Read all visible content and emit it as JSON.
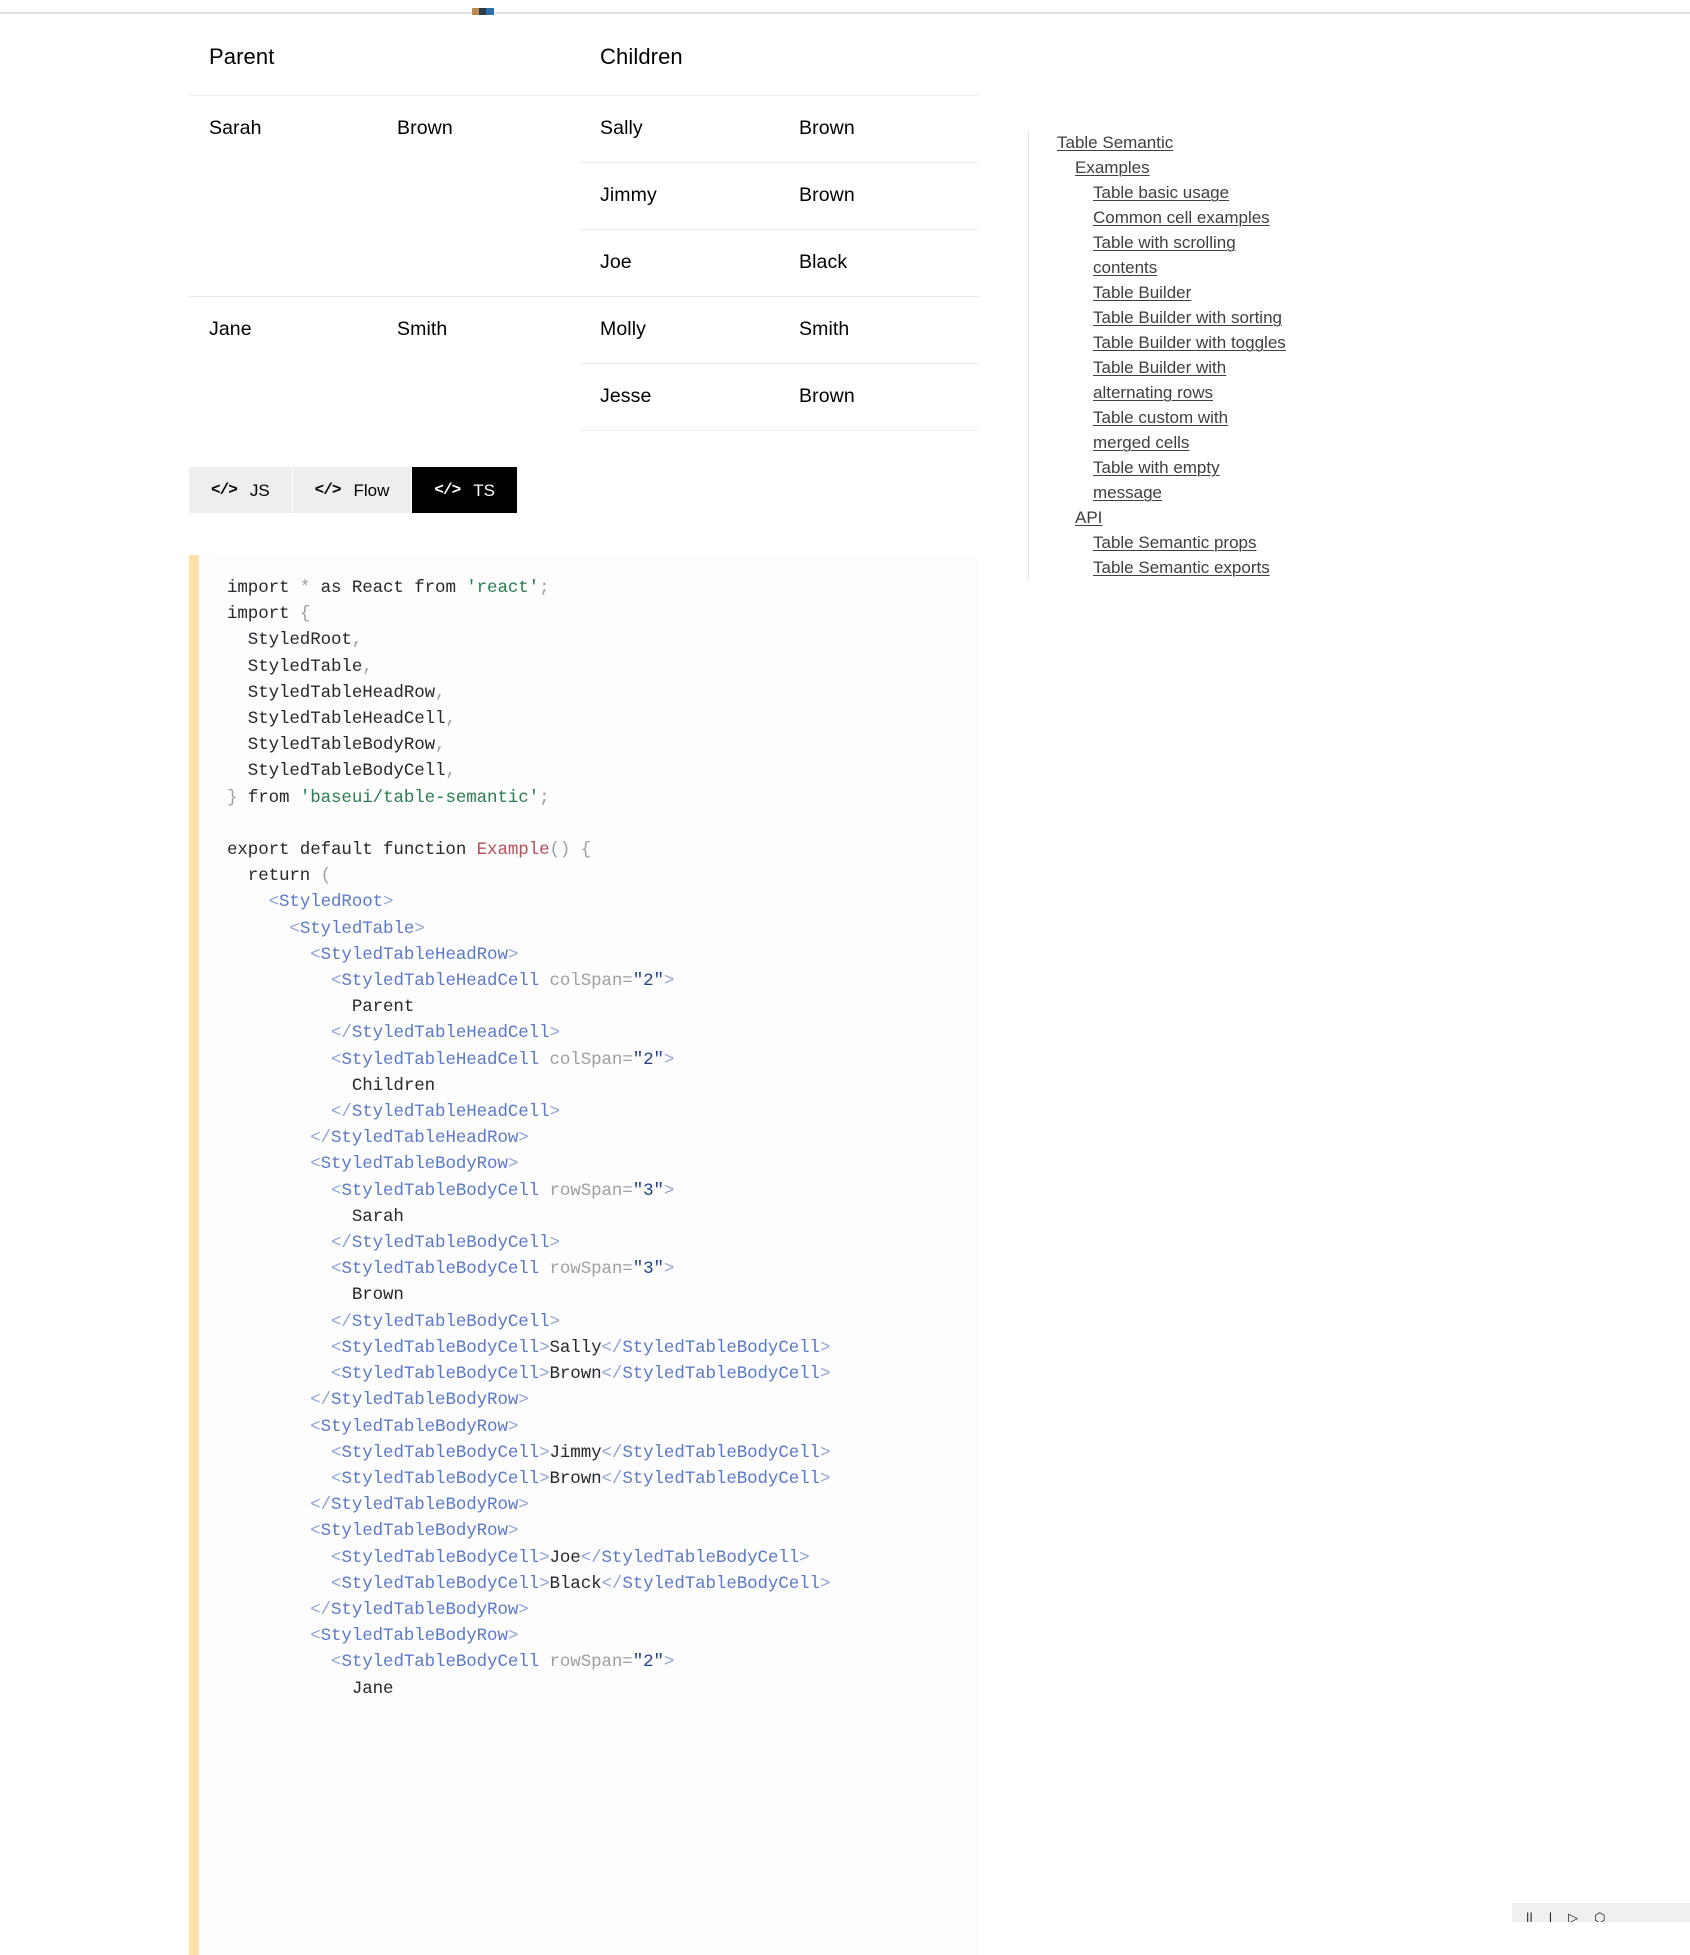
{
  "table": {
    "headers": [
      {
        "label": "Parent",
        "colspan": 2
      },
      {
        "label": "Children",
        "colspan": 2
      }
    ],
    "groups": [
      {
        "parent_first": "Sarah",
        "parent_last": "Brown",
        "rowspan": 3,
        "children": [
          {
            "first": "Sally",
            "last": "Brown"
          },
          {
            "first": "Jimmy",
            "last": "Brown"
          },
          {
            "first": "Joe",
            "last": "Black"
          }
        ]
      },
      {
        "parent_first": "Jane",
        "parent_last": "Smith",
        "rowspan": 2,
        "children": [
          {
            "first": "Molly",
            "last": "Smith"
          },
          {
            "first": "Jesse",
            "last": "Brown"
          }
        ]
      }
    ]
  },
  "tabs": {
    "icon": "</>",
    "items": [
      {
        "label": "JS",
        "active": false
      },
      {
        "label": "Flow",
        "active": false
      },
      {
        "label": "TS",
        "active": true
      }
    ]
  },
  "code": {
    "language": "TS",
    "lines": [
      [
        {
          "t": "import ",
          "c": "kw"
        },
        {
          "t": "* ",
          "c": "punc"
        },
        {
          "t": "as React from ",
          "c": "kw"
        },
        {
          "t": "'react'",
          "c": "str"
        },
        {
          "t": ";",
          "c": "punc"
        }
      ],
      [
        {
          "t": "import ",
          "c": "kw"
        },
        {
          "t": "{",
          "c": "punc"
        }
      ],
      [
        {
          "t": "  StyledRoot",
          "c": "kw"
        },
        {
          "t": ",",
          "c": "punc"
        }
      ],
      [
        {
          "t": "  StyledTable",
          "c": "kw"
        },
        {
          "t": ",",
          "c": "punc"
        }
      ],
      [
        {
          "t": "  StyledTableHeadRow",
          "c": "kw"
        },
        {
          "t": ",",
          "c": "punc"
        }
      ],
      [
        {
          "t": "  StyledTableHeadCell",
          "c": "kw"
        },
        {
          "t": ",",
          "c": "punc"
        }
      ],
      [
        {
          "t": "  StyledTableBodyRow",
          "c": "kw"
        },
        {
          "t": ",",
          "c": "punc"
        }
      ],
      [
        {
          "t": "  StyledTableBodyCell",
          "c": "kw"
        },
        {
          "t": ",",
          "c": "punc"
        }
      ],
      [
        {
          "t": "} ",
          "c": "punc"
        },
        {
          "t": "from ",
          "c": "kw"
        },
        {
          "t": "'baseui/table-semantic'",
          "c": "str"
        },
        {
          "t": ";",
          "c": "punc"
        }
      ],
      [],
      [
        {
          "t": "export default function ",
          "c": "kw"
        },
        {
          "t": "Example",
          "c": "fn"
        },
        {
          "t": "() {",
          "c": "punc"
        }
      ],
      [
        {
          "t": "  return ",
          "c": "kw"
        },
        {
          "t": "(",
          "c": "punc"
        }
      ],
      [
        {
          "t": "    ",
          "c": "kw"
        },
        {
          "t": "<",
          "c": "tagdim"
        },
        {
          "t": "StyledRoot",
          "c": "tag"
        },
        {
          "t": ">",
          "c": "tagdim"
        }
      ],
      [
        {
          "t": "      ",
          "c": "kw"
        },
        {
          "t": "<",
          "c": "tagdim"
        },
        {
          "t": "StyledTable",
          "c": "tag"
        },
        {
          "t": ">",
          "c": "tagdim"
        }
      ],
      [
        {
          "t": "        ",
          "c": "kw"
        },
        {
          "t": "<",
          "c": "tagdim"
        },
        {
          "t": "StyledTableHeadRow",
          "c": "tag"
        },
        {
          "t": ">",
          "c": "tagdim"
        }
      ],
      [
        {
          "t": "          ",
          "c": "kw"
        },
        {
          "t": "<",
          "c": "tagdim"
        },
        {
          "t": "StyledTableHeadCell ",
          "c": "tag"
        },
        {
          "t": "colSpan=",
          "c": "attr"
        },
        {
          "t": "\"2\"",
          "c": "attrval"
        },
        {
          "t": ">",
          "c": "tagdim"
        }
      ],
      [
        {
          "t": "            Parent",
          "c": "txt"
        }
      ],
      [
        {
          "t": "          ",
          "c": "kw"
        },
        {
          "t": "</",
          "c": "tagdim"
        },
        {
          "t": "StyledTableHeadCell",
          "c": "tag"
        },
        {
          "t": ">",
          "c": "tagdim"
        }
      ],
      [
        {
          "t": "          ",
          "c": "kw"
        },
        {
          "t": "<",
          "c": "tagdim"
        },
        {
          "t": "StyledTableHeadCell ",
          "c": "tag"
        },
        {
          "t": "colSpan=",
          "c": "attr"
        },
        {
          "t": "\"2\"",
          "c": "attrval"
        },
        {
          "t": ">",
          "c": "tagdim"
        }
      ],
      [
        {
          "t": "            Children",
          "c": "txt"
        }
      ],
      [
        {
          "t": "          ",
          "c": "kw"
        },
        {
          "t": "</",
          "c": "tagdim"
        },
        {
          "t": "StyledTableHeadCell",
          "c": "tag"
        },
        {
          "t": ">",
          "c": "tagdim"
        }
      ],
      [
        {
          "t": "        ",
          "c": "kw"
        },
        {
          "t": "</",
          "c": "tagdim"
        },
        {
          "t": "StyledTableHeadRow",
          "c": "tag"
        },
        {
          "t": ">",
          "c": "tagdim"
        }
      ],
      [
        {
          "t": "        ",
          "c": "kw"
        },
        {
          "t": "<",
          "c": "tagdim"
        },
        {
          "t": "StyledTableBodyRow",
          "c": "tag"
        },
        {
          "t": ">",
          "c": "tagdim"
        }
      ],
      [
        {
          "t": "          ",
          "c": "kw"
        },
        {
          "t": "<",
          "c": "tagdim"
        },
        {
          "t": "StyledTableBodyCell ",
          "c": "tag"
        },
        {
          "t": "rowSpan=",
          "c": "attr"
        },
        {
          "t": "\"3\"",
          "c": "attrval"
        },
        {
          "t": ">",
          "c": "tagdim"
        }
      ],
      [
        {
          "t": "            Sarah",
          "c": "txt"
        }
      ],
      [
        {
          "t": "          ",
          "c": "kw"
        },
        {
          "t": "</",
          "c": "tagdim"
        },
        {
          "t": "StyledTableBodyCell",
          "c": "tag"
        },
        {
          "t": ">",
          "c": "tagdim"
        }
      ],
      [
        {
          "t": "          ",
          "c": "kw"
        },
        {
          "t": "<",
          "c": "tagdim"
        },
        {
          "t": "StyledTableBodyCell ",
          "c": "tag"
        },
        {
          "t": "rowSpan=",
          "c": "attr"
        },
        {
          "t": "\"3\"",
          "c": "attrval"
        },
        {
          "t": ">",
          "c": "tagdim"
        }
      ],
      [
        {
          "t": "            Brown",
          "c": "txt"
        }
      ],
      [
        {
          "t": "          ",
          "c": "kw"
        },
        {
          "t": "</",
          "c": "tagdim"
        },
        {
          "t": "StyledTableBodyCell",
          "c": "tag"
        },
        {
          "t": ">",
          "c": "tagdim"
        }
      ],
      [
        {
          "t": "          ",
          "c": "kw"
        },
        {
          "t": "<",
          "c": "tagdim"
        },
        {
          "t": "StyledTableBodyCell",
          "c": "tag"
        },
        {
          "t": ">",
          "c": "tagdim"
        },
        {
          "t": "Sally",
          "c": "txt"
        },
        {
          "t": "</",
          "c": "tagdim"
        },
        {
          "t": "StyledTableBodyCell",
          "c": "tag"
        },
        {
          "t": ">",
          "c": "tagdim"
        }
      ],
      [
        {
          "t": "          ",
          "c": "kw"
        },
        {
          "t": "<",
          "c": "tagdim"
        },
        {
          "t": "StyledTableBodyCell",
          "c": "tag"
        },
        {
          "t": ">",
          "c": "tagdim"
        },
        {
          "t": "Brown",
          "c": "txt"
        },
        {
          "t": "</",
          "c": "tagdim"
        },
        {
          "t": "StyledTableBodyCell",
          "c": "tag"
        },
        {
          "t": ">",
          "c": "tagdim"
        }
      ],
      [
        {
          "t": "        ",
          "c": "kw"
        },
        {
          "t": "</",
          "c": "tagdim"
        },
        {
          "t": "StyledTableBodyRow",
          "c": "tag"
        },
        {
          "t": ">",
          "c": "tagdim"
        }
      ],
      [
        {
          "t": "        ",
          "c": "kw"
        },
        {
          "t": "<",
          "c": "tagdim"
        },
        {
          "t": "StyledTableBodyRow",
          "c": "tag"
        },
        {
          "t": ">",
          "c": "tagdim"
        }
      ],
      [
        {
          "t": "          ",
          "c": "kw"
        },
        {
          "t": "<",
          "c": "tagdim"
        },
        {
          "t": "StyledTableBodyCell",
          "c": "tag"
        },
        {
          "t": ">",
          "c": "tagdim"
        },
        {
          "t": "Jimmy",
          "c": "txt"
        },
        {
          "t": "</",
          "c": "tagdim"
        },
        {
          "t": "StyledTableBodyCell",
          "c": "tag"
        },
        {
          "t": ">",
          "c": "tagdim"
        }
      ],
      [
        {
          "t": "          ",
          "c": "kw"
        },
        {
          "t": "<",
          "c": "tagdim"
        },
        {
          "t": "StyledTableBodyCell",
          "c": "tag"
        },
        {
          "t": ">",
          "c": "tagdim"
        },
        {
          "t": "Brown",
          "c": "txt"
        },
        {
          "t": "</",
          "c": "tagdim"
        },
        {
          "t": "StyledTableBodyCell",
          "c": "tag"
        },
        {
          "t": ">",
          "c": "tagdim"
        }
      ],
      [
        {
          "t": "        ",
          "c": "kw"
        },
        {
          "t": "</",
          "c": "tagdim"
        },
        {
          "t": "StyledTableBodyRow",
          "c": "tag"
        },
        {
          "t": ">",
          "c": "tagdim"
        }
      ],
      [
        {
          "t": "        ",
          "c": "kw"
        },
        {
          "t": "<",
          "c": "tagdim"
        },
        {
          "t": "StyledTableBodyRow",
          "c": "tag"
        },
        {
          "t": ">",
          "c": "tagdim"
        }
      ],
      [
        {
          "t": "          ",
          "c": "kw"
        },
        {
          "t": "<",
          "c": "tagdim"
        },
        {
          "t": "StyledTableBodyCell",
          "c": "tag"
        },
        {
          "t": ">",
          "c": "tagdim"
        },
        {
          "t": "Joe",
          "c": "txt"
        },
        {
          "t": "</",
          "c": "tagdim"
        },
        {
          "t": "StyledTableBodyCell",
          "c": "tag"
        },
        {
          "t": ">",
          "c": "tagdim"
        }
      ],
      [
        {
          "t": "          ",
          "c": "kw"
        },
        {
          "t": "<",
          "c": "tagdim"
        },
        {
          "t": "StyledTableBodyCell",
          "c": "tag"
        },
        {
          "t": ">",
          "c": "tagdim"
        },
        {
          "t": "Black",
          "c": "txt"
        },
        {
          "t": "</",
          "c": "tagdim"
        },
        {
          "t": "StyledTableBodyCell",
          "c": "tag"
        },
        {
          "t": ">",
          "c": "tagdim"
        }
      ],
      [
        {
          "t": "        ",
          "c": "kw"
        },
        {
          "t": "</",
          "c": "tagdim"
        },
        {
          "t": "StyledTableBodyRow",
          "c": "tag"
        },
        {
          "t": ">",
          "c": "tagdim"
        }
      ],
      [
        {
          "t": "        ",
          "c": "kw"
        },
        {
          "t": "<",
          "c": "tagdim"
        },
        {
          "t": "StyledTableBodyRow",
          "c": "tag"
        },
        {
          "t": ">",
          "c": "tagdim"
        }
      ],
      [
        {
          "t": "          ",
          "c": "kw"
        },
        {
          "t": "<",
          "c": "tagdim"
        },
        {
          "t": "StyledTableBodyCell ",
          "c": "tag"
        },
        {
          "t": "rowSpan=",
          "c": "attr"
        },
        {
          "t": "\"2\"",
          "c": "attrval"
        },
        {
          "t": ">",
          "c": "tagdim"
        }
      ],
      [
        {
          "t": "            Jane",
          "c": "txt"
        }
      ]
    ]
  },
  "toc": {
    "items": [
      {
        "label": "Table Semantic",
        "level": 0
      },
      {
        "label": "Examples",
        "level": 1
      },
      {
        "label": "Table basic usage",
        "level": 2
      },
      {
        "label": "Common cell examples",
        "level": 2
      },
      {
        "label": "Table with scrolling contents",
        "level": 2
      },
      {
        "label": "Table Builder",
        "level": 2
      },
      {
        "label": "Table Builder with sorting",
        "level": 2
      },
      {
        "label": "Table Builder with toggles",
        "level": 2
      },
      {
        "label": "Table Builder with alternating rows",
        "level": 2
      },
      {
        "label": "Table custom with merged cells",
        "level": 2
      },
      {
        "label": "Table with empty message",
        "level": 2
      },
      {
        "label": "API",
        "level": 1
      },
      {
        "label": "Table Semantic props",
        "level": 2
      },
      {
        "label": "Table Semantic exports",
        "level": 2
      }
    ]
  },
  "bottombar": {
    "items": [
      "||",
      "|",
      "▷",
      "⬡"
    ]
  }
}
